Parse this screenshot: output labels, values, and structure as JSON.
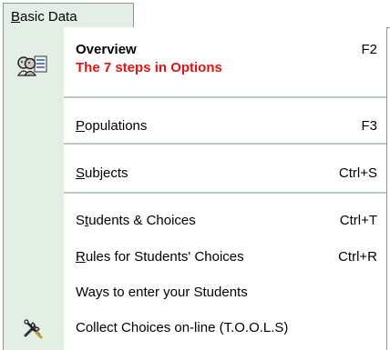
{
  "tab": {
    "label": "Basic Data",
    "accel_letter": "B",
    "rest": "asic Data"
  },
  "menu": {
    "items": [
      {
        "label": "Overview",
        "shortcut": "F2",
        "sub": "The 7 steps in Options"
      },
      {
        "accel": "P",
        "rest": "opulations",
        "shortcut": "F3"
      },
      {
        "accel": "S",
        "rest": "ubjects",
        "shortcut": "Ctrl+S"
      },
      {
        "pre": "S",
        "accel": "t",
        "rest": "udents & Choices",
        "shortcut": "Ctrl+T"
      },
      {
        "accel": "R",
        "rest": "ules for Students' Choices",
        "shortcut": "Ctrl+R"
      },
      {
        "label": "Ways to enter your Students"
      },
      {
        "label": "Collect Choices on-line (T.O.O.L.S)"
      }
    ]
  },
  "icons": {
    "overview": "students-overview-icon",
    "tools": "tools-wrench-icon"
  },
  "colors": {
    "gutter": "#e3efe5",
    "separator": "#b5cdba",
    "sub_text": "#e81010"
  }
}
